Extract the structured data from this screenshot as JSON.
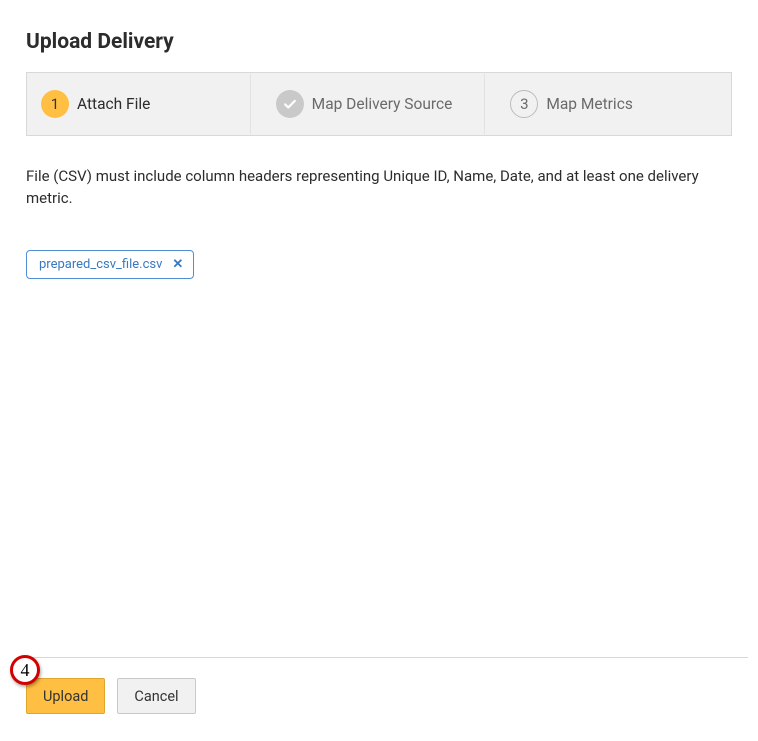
{
  "title": "Upload Delivery",
  "stepper": {
    "steps": [
      {
        "index": "1",
        "label": "Attach File",
        "state": "active"
      },
      {
        "index": "check",
        "label": "Map Delivery Source",
        "state": "disabled"
      },
      {
        "index": "3",
        "label": "Map Metrics",
        "state": "pending"
      }
    ]
  },
  "help_text": "File (CSV) must include column headers representing Unique ID, Name, Date, and at least one delivery metric.",
  "attached_file": {
    "name": "prepared_csv_file.csv",
    "remove_glyph": "✕"
  },
  "footer": {
    "upload_label": "Upload",
    "cancel_label": "Cancel"
  },
  "annotation": {
    "marker": "4"
  }
}
